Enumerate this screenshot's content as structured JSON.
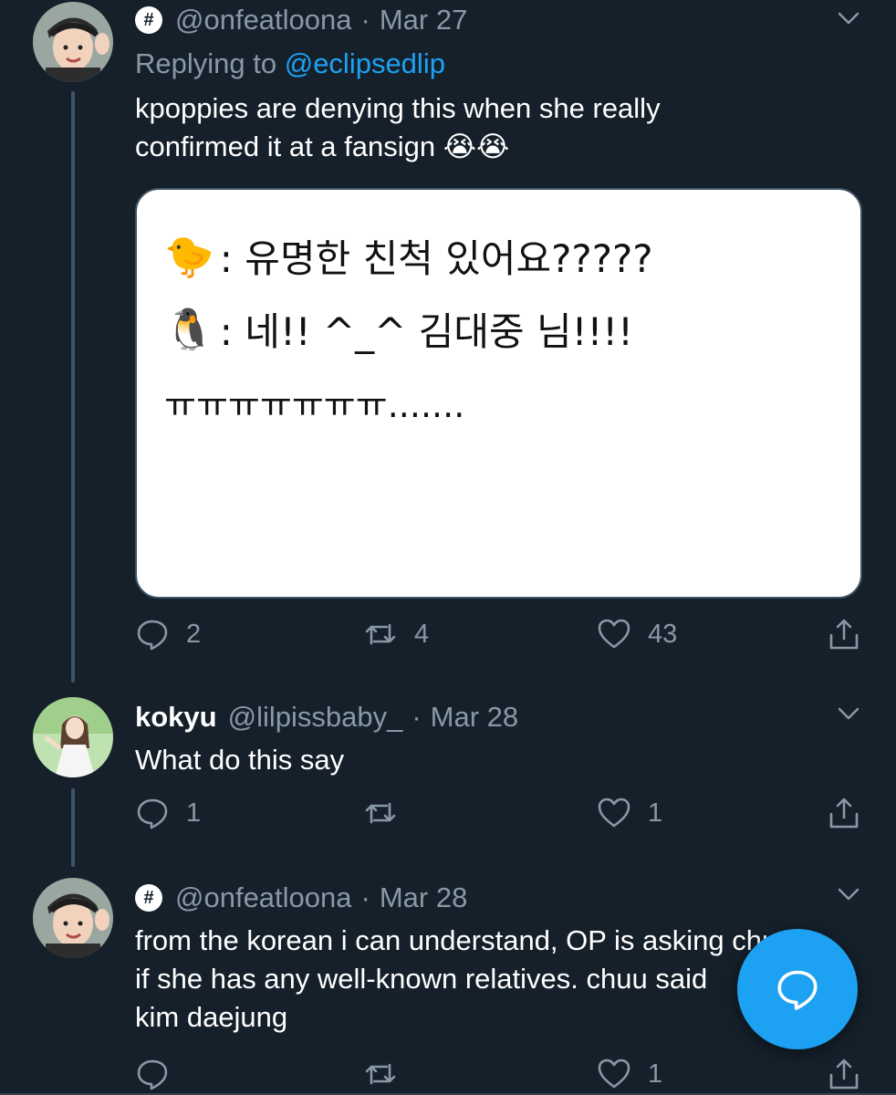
{
  "tweets": [
    {
      "handle": "@onfeatloona",
      "separator": "·",
      "date": "Mar 27",
      "badge": "#",
      "reply_prefix": "Replying to",
      "reply_to": "@eclipsedlip",
      "text_line1": "kpoppies are denying this when she really",
      "text_line2": "confirmed it at a fansign 😭😭",
      "media": {
        "line1_emoji": "🐤",
        "line1_text": ": 유명한 친척 있어요?????",
        "line2_emoji": "🐧",
        "line2_text": ": 네!! ^_^ 김대중 님!!!!",
        "line3_text": "ㅠㅠㅠㅠㅠㅠㅠ......."
      },
      "replies": "2",
      "retweets": "4",
      "likes": "43"
    },
    {
      "name": "kokyu",
      "handle": "@lilpissbaby_",
      "separator": "·",
      "date": "Mar 28",
      "text": "What do this say",
      "replies": "1",
      "retweets": "",
      "likes": "1"
    },
    {
      "handle": "@onfeatloona",
      "separator": "·",
      "date": "Mar 28",
      "badge": "#",
      "text_line1": "from the korean i can understand, OP is asking chuu",
      "text_line2": "if she has any well-known relatives. chuu said",
      "text_line3": "kim daejung",
      "replies": "",
      "retweets": "",
      "likes": "1"
    }
  ],
  "colors": {
    "background": "#15202b",
    "muted": "#8899a6",
    "accent": "#1da1f2",
    "thread": "#3d5466"
  },
  "icons": [
    "chevron-down-icon",
    "reply-icon",
    "retweet-icon",
    "like-icon",
    "share-icon",
    "compose-icon"
  ]
}
